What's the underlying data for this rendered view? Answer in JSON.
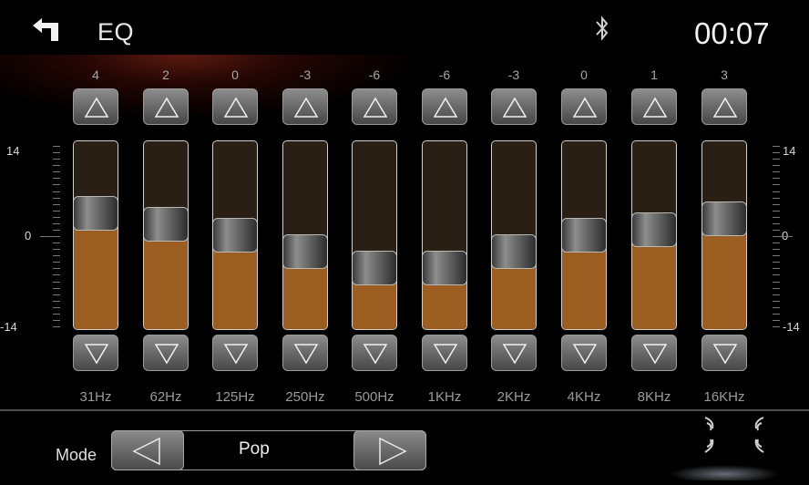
{
  "header": {
    "title": "EQ",
    "clock": "00:07",
    "back_icon": "back-arrow-icon",
    "bluetooth_icon": "bluetooth-icon"
  },
  "scale": {
    "top": "14",
    "middle": "0",
    "bottom": "-14"
  },
  "bands": [
    {
      "label": "31Hz",
      "value": "4"
    },
    {
      "label": "62Hz",
      "value": "2"
    },
    {
      "label": "125Hz",
      "value": "0"
    },
    {
      "label": "250Hz",
      "value": "-3"
    },
    {
      "label": "500Hz",
      "value": "-6"
    },
    {
      "label": "1KHz",
      "value": "-6"
    },
    {
      "label": "2KHz",
      "value": "-3"
    },
    {
      "label": "4KHz",
      "value": "0"
    },
    {
      "label": "8KHz",
      "value": "1"
    },
    {
      "label": "16KHz",
      "value": "3"
    }
  ],
  "range": {
    "min": -14,
    "max": 14
  },
  "mode": {
    "label": "Mode",
    "value": "Pop"
  },
  "colors": {
    "fill": "#9b5e20",
    "track": "#2a1f15",
    "accent_glow": "#5a1a10"
  },
  "surround_icon": "surround-sound-icon"
}
